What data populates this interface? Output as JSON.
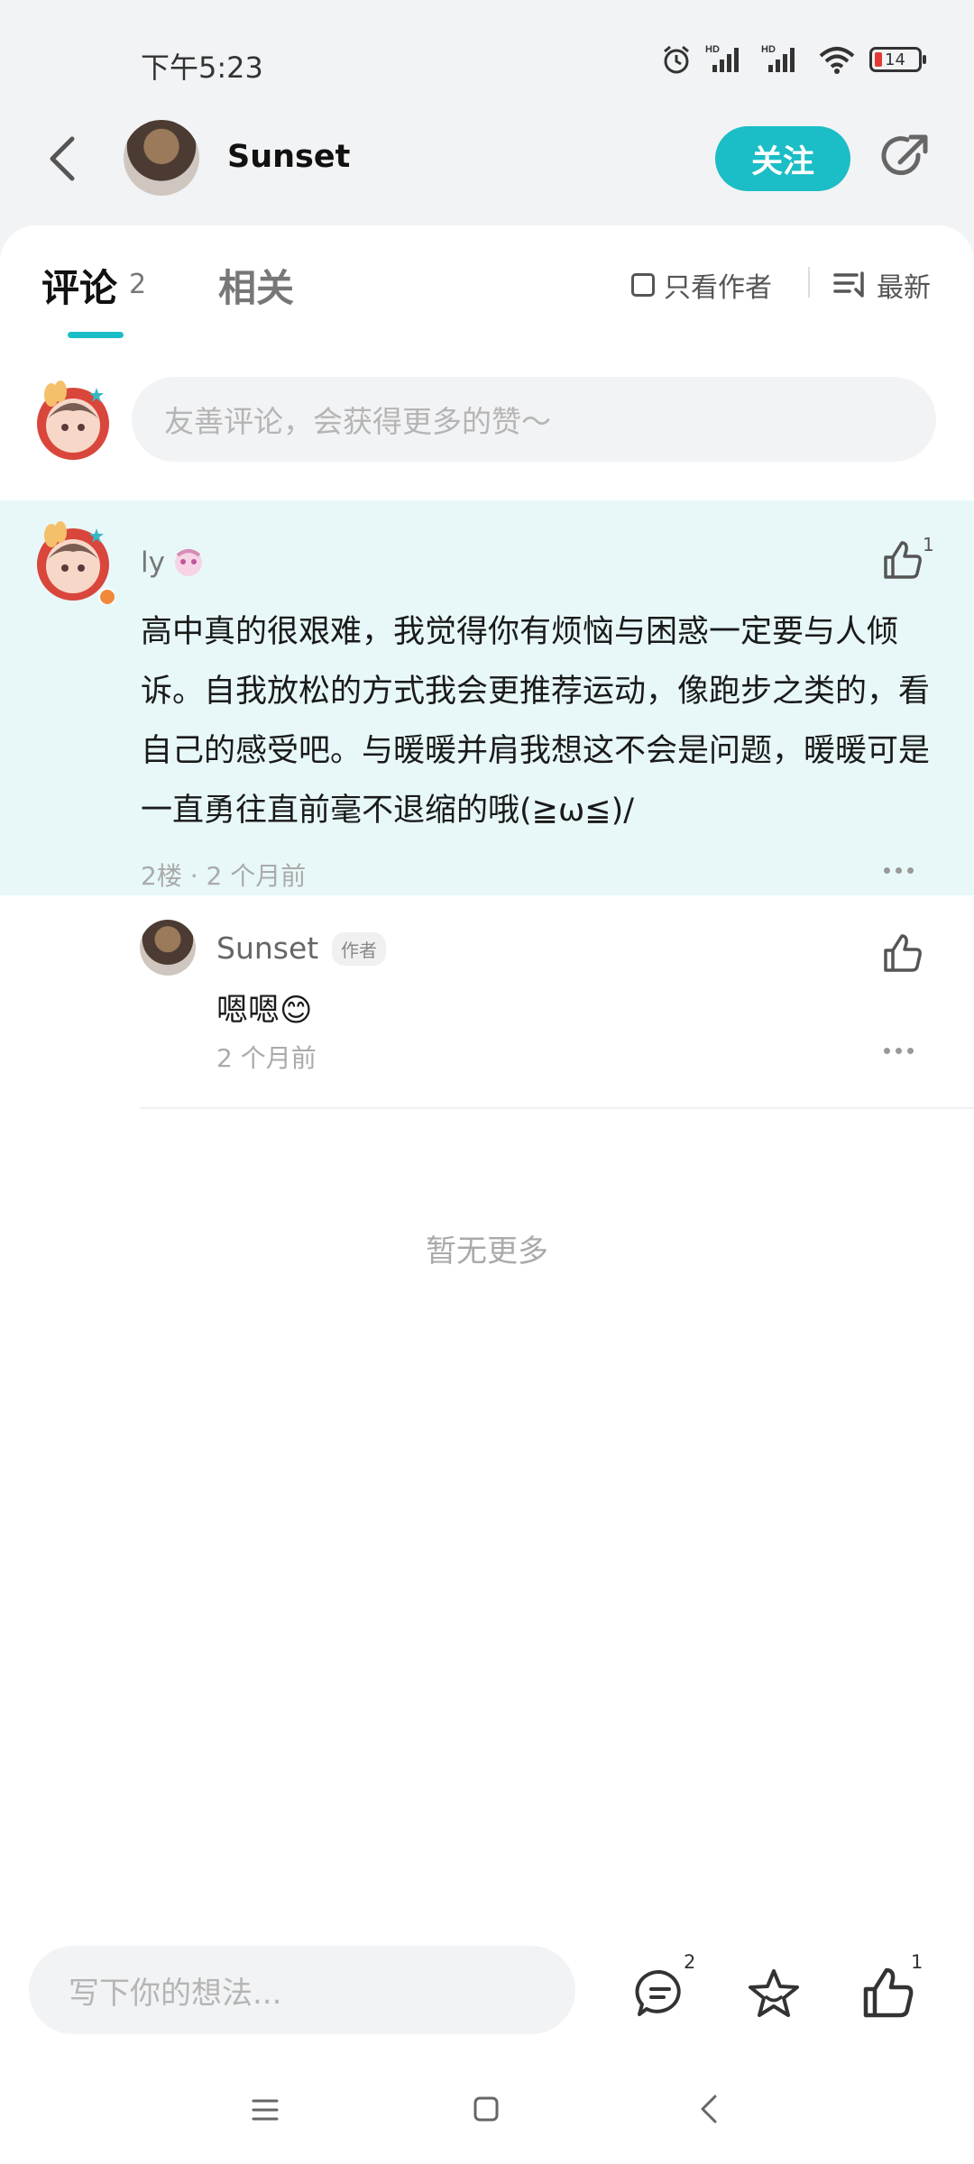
{
  "status_bar": {
    "time": "下午5:23",
    "battery": "14",
    "icons": [
      "alarm-icon",
      "hd-signal-icon",
      "hd-signal-icon",
      "wifi-icon",
      "battery-icon"
    ]
  },
  "header": {
    "user_name": "Sunset",
    "follow_label": "关注",
    "icons": [
      "back-icon",
      "share-icon"
    ]
  },
  "tabs": {
    "comments_label": "评论",
    "comments_count": "2",
    "related_label": "相关",
    "author_only_label": "只看作者",
    "sort_label": "最新"
  },
  "comment_input": {
    "placeholder": "友善评论，会获得更多的赞～"
  },
  "comments": [
    {
      "user": "ly",
      "text": "高中真的很艰难，我觉得你有烦恼与困惑一定要与人倾诉。自我放松的方式我会更推荐运动，像跑步之类的，看自己的感受吧。与暖暖并肩我想这不会是问题，暖暖可是一直勇往直前毫不退缩的哦(≧ω≦)/",
      "meta": "2楼 · 2 个月前",
      "likes": "1",
      "replies": [
        {
          "user": "Sunset",
          "badge": "作者",
          "text": "嗯嗯😊",
          "time": "2 个月前"
        }
      ]
    }
  ],
  "footer_note": "暂无更多",
  "bottom_bar": {
    "placeholder": "写下你的想法...",
    "comment_count": "2",
    "like_count": "1"
  },
  "colors": {
    "accent": "#1bbdc6",
    "highlight": "#e8f8f9"
  }
}
